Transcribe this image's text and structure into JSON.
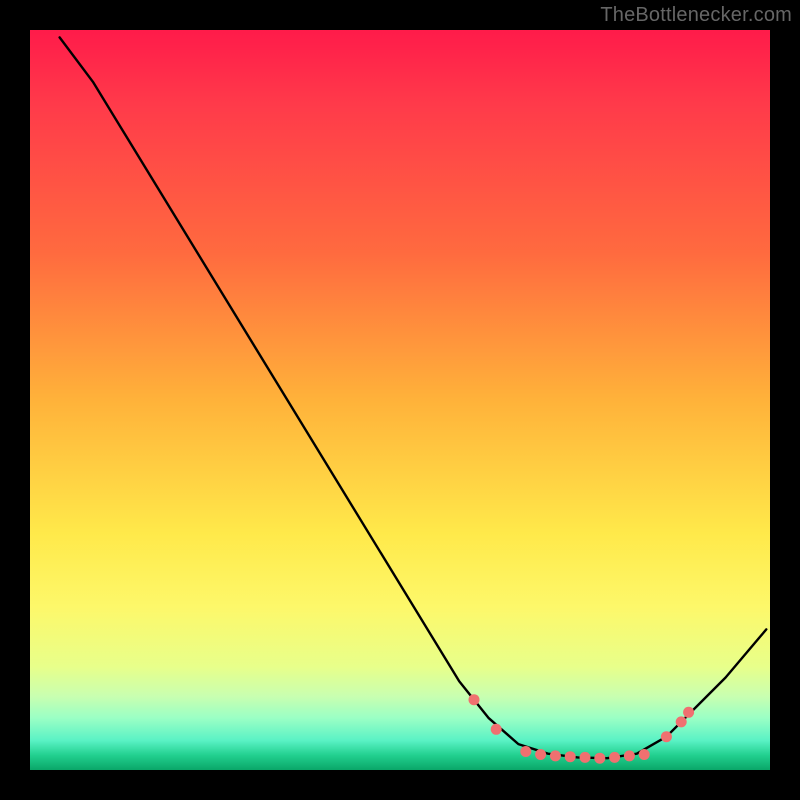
{
  "attribution": "TheBottlenecker.com",
  "chart_data": {
    "type": "line",
    "title": "",
    "xlabel": "",
    "ylabel": "",
    "xlim": [
      0,
      100
    ],
    "ylim": [
      0,
      100
    ],
    "curve": {
      "name": "bottleneck-curve",
      "points": [
        {
          "x": 4,
          "y": 99
        },
        {
          "x": 8.5,
          "y": 93
        },
        {
          "x": 58,
          "y": 12
        },
        {
          "x": 62,
          "y": 7
        },
        {
          "x": 66,
          "y": 3.5
        },
        {
          "x": 70,
          "y": 2.2
        },
        {
          "x": 74,
          "y": 1.7
        },
        {
          "x": 78,
          "y": 1.6
        },
        {
          "x": 82,
          "y": 2.2
        },
        {
          "x": 86,
          "y": 4.5
        },
        {
          "x": 90,
          "y": 8.5
        },
        {
          "x": 94,
          "y": 12.5
        },
        {
          "x": 99.5,
          "y": 19
        }
      ]
    },
    "markers": {
      "name": "highlight-dots",
      "color": "#f07070",
      "radius_px": 5.5,
      "points": [
        {
          "x": 60,
          "y": 9.5
        },
        {
          "x": 63,
          "y": 5.5
        },
        {
          "x": 67,
          "y": 2.5
        },
        {
          "x": 69,
          "y": 2.1
        },
        {
          "x": 71,
          "y": 1.9
        },
        {
          "x": 73,
          "y": 1.8
        },
        {
          "x": 75,
          "y": 1.7
        },
        {
          "x": 77,
          "y": 1.6
        },
        {
          "x": 79,
          "y": 1.7
        },
        {
          "x": 81,
          "y": 1.9
        },
        {
          "x": 83,
          "y": 2.1
        },
        {
          "x": 86,
          "y": 4.5
        },
        {
          "x": 88,
          "y": 6.5
        },
        {
          "x": 89,
          "y": 7.8
        }
      ]
    }
  }
}
